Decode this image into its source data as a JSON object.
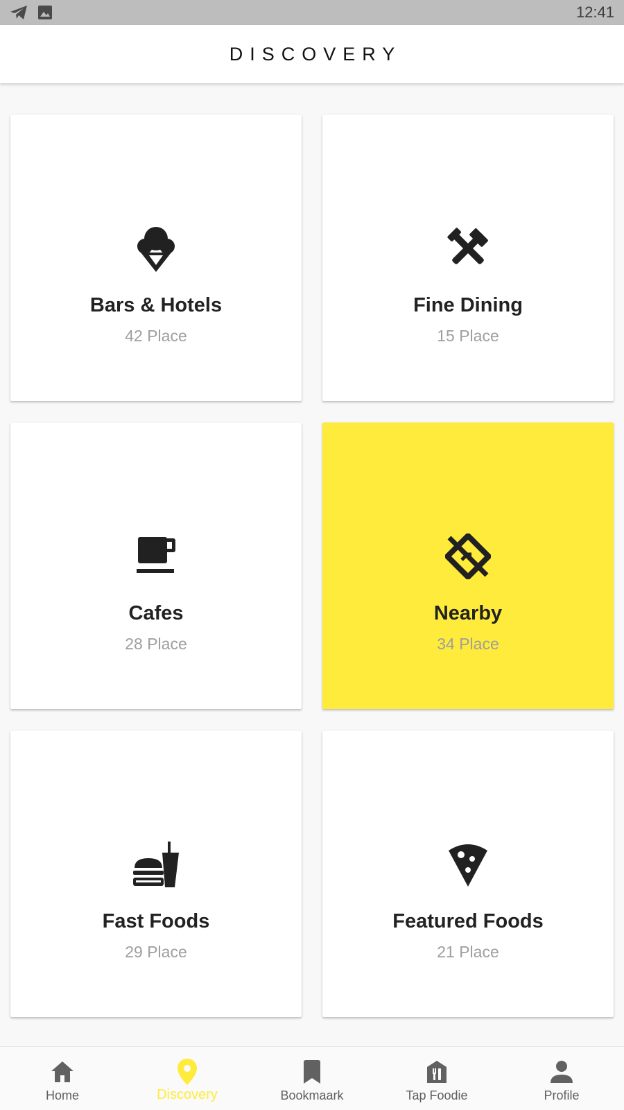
{
  "status_bar": {
    "time": "12:41",
    "icons": [
      "telegram-icon",
      "image-icon"
    ]
  },
  "header": {
    "title": "DISCOVERY"
  },
  "colors": {
    "accent": "#ffeb3b",
    "icon": "#212121",
    "nav_inactive": "#616161"
  },
  "categories": [
    {
      "title": "Bars & Hotels",
      "count": "42 Place",
      "icon": "ice-cream-icon",
      "active": false
    },
    {
      "title": "Fine Dining",
      "count": "15 Place",
      "icon": "crossed-tools-icon",
      "active": false
    },
    {
      "title": "Cafes",
      "count": "28 Place",
      "icon": "coffee-cup-icon",
      "active": false
    },
    {
      "title": "Nearby",
      "count": "34 Place",
      "icon": "no-directions-icon",
      "active": true
    },
    {
      "title": "Fast Foods",
      "count": "29 Place",
      "icon": "fast-food-icon",
      "active": false
    },
    {
      "title": "Featured Foods",
      "count": "21 Place",
      "icon": "pizza-slice-icon",
      "active": false
    }
  ],
  "bottom_nav": {
    "items": [
      {
        "label": "Home",
        "icon": "home-icon",
        "active": false
      },
      {
        "label": "Discovery",
        "icon": "location-pin-icon",
        "active": true
      },
      {
        "label": "Bookmaark",
        "icon": "bookmark-icon",
        "active": false
      },
      {
        "label": "Tap Foodie",
        "icon": "restaurant-store-icon",
        "active": false
      },
      {
        "label": "Profile",
        "icon": "person-icon",
        "active": false
      }
    ]
  }
}
